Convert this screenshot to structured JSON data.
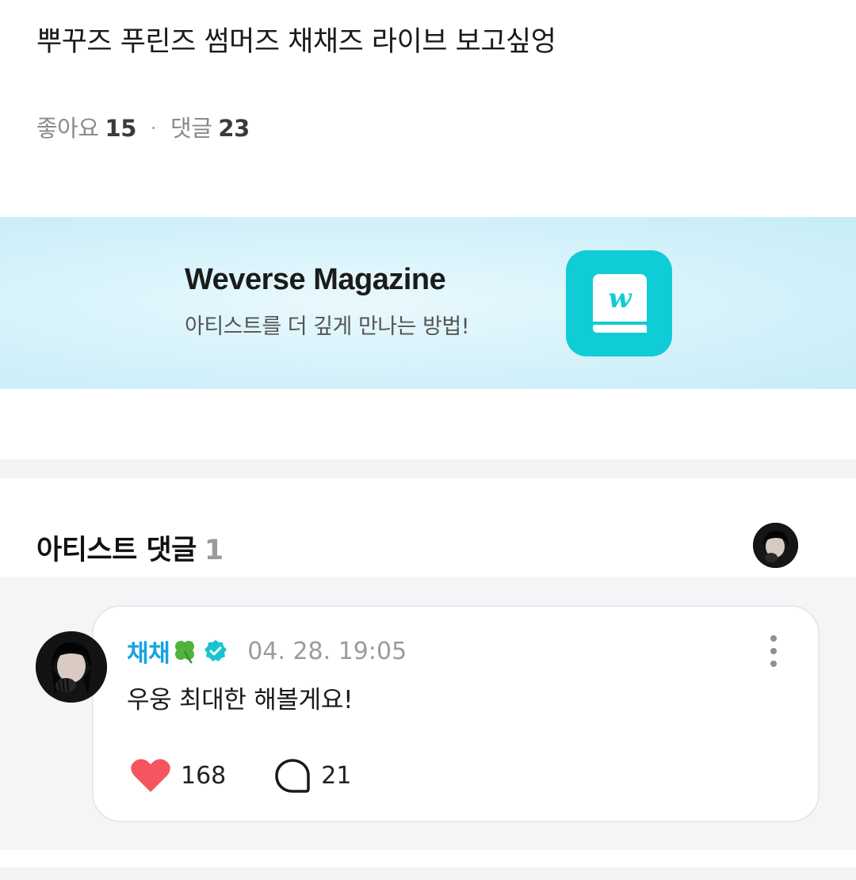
{
  "post": {
    "title": "뿌꾸즈 푸린즈 썸머즈 채채즈 라이브 보고싶엉",
    "likes_label": "좋아요",
    "likes_count": "15",
    "separator": "·",
    "comments_label": "댓글",
    "comments_count": "23"
  },
  "banner": {
    "title": "Weverse Magazine",
    "subtitle": "아티스트를 더 깊게 만나는 방법!",
    "icon": "weverse-magazine-app-icon",
    "accent_color": "#10ccd6"
  },
  "artist_comments": {
    "header_label": "아티스트 댓글",
    "count": "1"
  },
  "comment": {
    "author": "채채",
    "author_emoji": "clover-icon",
    "verified_icon": "verified-badge-icon",
    "date": "04. 28. 19:05",
    "text": "우웅 최대한 해볼게요!",
    "like_count": "168",
    "reply_count": "21",
    "author_color": "#14a3e3",
    "like_color": "#f4555f"
  }
}
